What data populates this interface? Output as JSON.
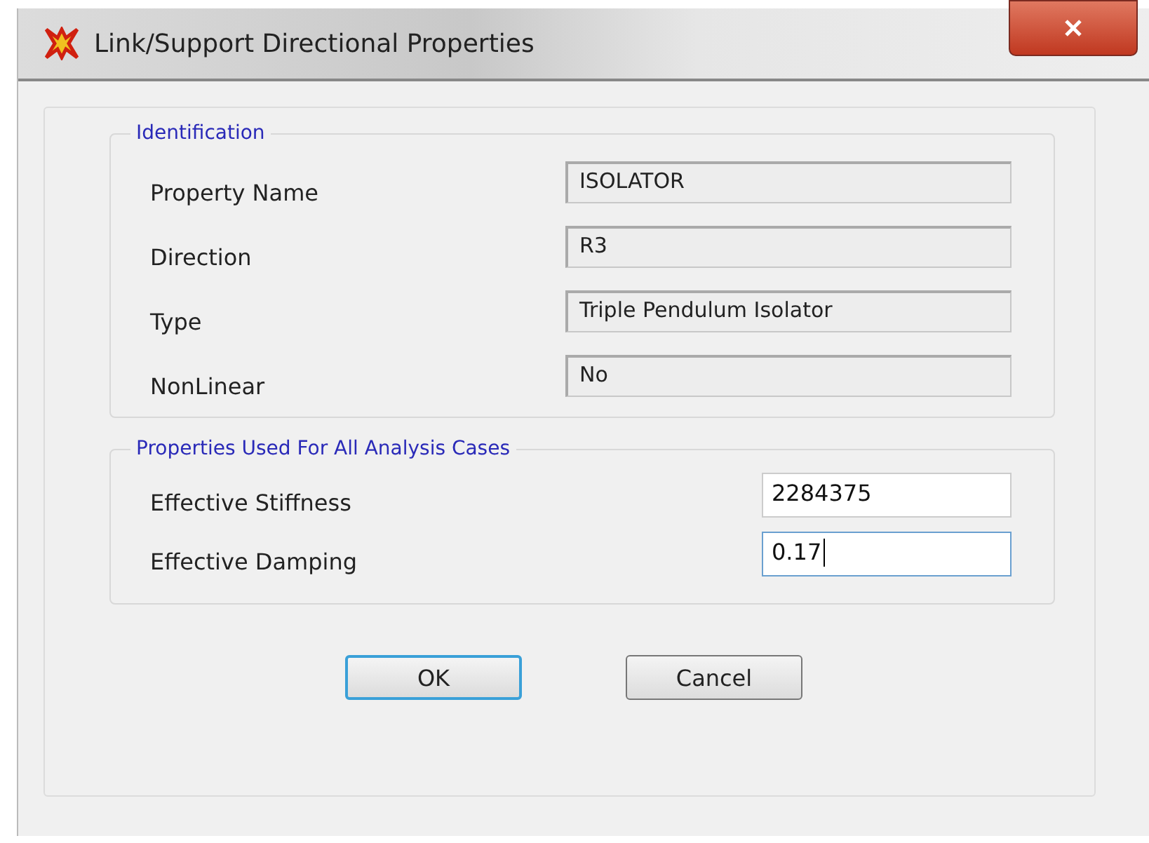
{
  "window": {
    "title": "Link/Support Directional Properties"
  },
  "identification": {
    "title": "Identification",
    "rows": [
      {
        "label": "Property Name",
        "value": "ISOLATOR"
      },
      {
        "label": "Direction",
        "value": "R3"
      },
      {
        "label": "Type",
        "value": "Triple Pendulum Isolator"
      },
      {
        "label": "NonLinear",
        "value": "No"
      }
    ]
  },
  "properties": {
    "title": "Properties Used For All Analysis Cases",
    "rows": [
      {
        "label": "Effective Stiffness",
        "value": "2284375",
        "focused": false
      },
      {
        "label": "Effective Damping",
        "value": "0.17",
        "focused": true
      }
    ]
  },
  "buttons": [
    {
      "label": "OK",
      "default": true
    },
    {
      "label": "Cancel",
      "default": false
    }
  ]
}
